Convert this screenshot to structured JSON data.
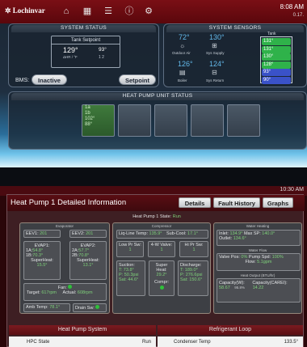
{
  "top": {
    "logo": "Lochinvar",
    "nav_icons": [
      "home-icon",
      "grid-icon",
      "sliders-icon",
      "info-icon",
      "gear-icon"
    ],
    "time": "8:08 AM",
    "date": "0.17.",
    "system_status": {
      "title": "SYSTEM STATUS",
      "tank_title": "Tank Setpoint",
      "tank_value": "129°",
      "tank_unit": "ΔHR / °F",
      "tank_side_value": "93°",
      "tank_side_sub": "1 2",
      "bms_label": "BMS:",
      "bms_value": "Inactive",
      "setpoint_button": "Setpoint"
    },
    "system_sensors": {
      "title": "SYSTEM SENSORS",
      "outdoor_value": "72°",
      "outdoor_label": "Outdoor Air",
      "supply_value": "130°",
      "supply_label": "Sys Supply",
      "boiler_value": "126°",
      "boiler_label": "Boiler",
      "return_value": "124°",
      "return_label": "Sys Return",
      "tank_label": "Tank",
      "tank_temps": [
        "131°",
        "131°",
        "130°",
        "128°",
        "93°",
        "90°"
      ]
    },
    "hp_status": {
      "title": "HEAT PUMP UNIT STATUS",
      "cell1": [
        "1a",
        "1b",
        "102°",
        "88°"
      ]
    }
  },
  "detail": {
    "title": "Heat Pump 1 Detailed Information",
    "time": "10:30 AM",
    "tab_details": "Details",
    "tab_fault": "Fault History",
    "tab_graphs": "Graphs",
    "state_label": "Heat Pump 1 State:",
    "state_value": "Run",
    "evaporator": {
      "tag": "Evaporator",
      "eev1": "EEV1:",
      "eev1_val": "201",
      "eev2": "EEV2:",
      "eev2_val": "201",
      "evap1": "EVAP1:",
      "evap2": "EVAP2:",
      "e1a": "1A:",
      "e1a_val": "54.8°",
      "e1b": "1B:",
      "e1b_val": "70.3°",
      "e2a": "2A:",
      "e2a_val": "57.7°",
      "e2b": "2B:",
      "e2b_val": "70.8°",
      "sh1_label": "SuperHeat:",
      "sh1_val": "15.5°",
      "sh2_label": "SuperHeat:",
      "sh2_val": "13.1°",
      "fan_label": "Fan:",
      "target_label": "Target:",
      "target_val": "617rpm",
      "actual_label": "Actual:",
      "actual_val": "608rpm",
      "amb_label": "Amb Temp:",
      "amb_val": "78.1°",
      "drain_label": "Drain Sw:"
    },
    "compressor": {
      "tag": "Compressor",
      "liq_label": "Liq-Line Temp:",
      "liq_val": "135.9°",
      "subcool_label": "Sub-Cool:",
      "subcool_val": "17.1°",
      "lowpr_label": "Low Pr Sw:",
      "lowpr_val": "1",
      "valve_label": "4-W Valve:",
      "valve_val": "1",
      "hipr_label": "Hi Pr Sw:",
      "hipr_val": "1",
      "suction_label": "Suction:",
      "suction_t": "T: 73.8°",
      "suction_p": "P: 50.3psi",
      "suction_s": "Sat: 44.6°",
      "superheat_label": "Super Heat:",
      "superheat_val": "29.2°",
      "discharge_label": "Discharge:",
      "discharge_t": "T: 189.0°",
      "discharge_p": "P: 276.6psi",
      "discharge_s": "Sat: 150.6°",
      "compr_label": "Compr:"
    },
    "water": {
      "tag": "Water Heating",
      "inlet_label": "Inlet:",
      "inlet_val": "134.9°",
      "maxsp_label": "Max SP:",
      "maxsp_val": "140.0°",
      "outlet_label": "Outlet:",
      "outlet_val": "134.6°",
      "flow_tag": "Water Flow",
      "valvepos_label": "Valve Pos:",
      "valvepos_val": "0%",
      "pumpspd_label": "Pump Spd:",
      "pumpspd_val": "100%",
      "flow_label": "Flow:",
      "flow_val": "5.1gpm",
      "output_tag": "Heat Output (BTU/hr)",
      "cap_label": "Capacity(W):",
      "cap_val": "58.67",
      "cap_pct": "95.8%",
      "carei_label": "Capacity(CAREI):",
      "carei_val": "14.22"
    },
    "sec_hp": "Heat Pump System",
    "sec_ref": "Refrigerant Loop",
    "row_hpc": "HPC State",
    "row_hpc_val": "Run",
    "row_cond": "Condenser Temp",
    "row_cond_val": "133.5°"
  }
}
